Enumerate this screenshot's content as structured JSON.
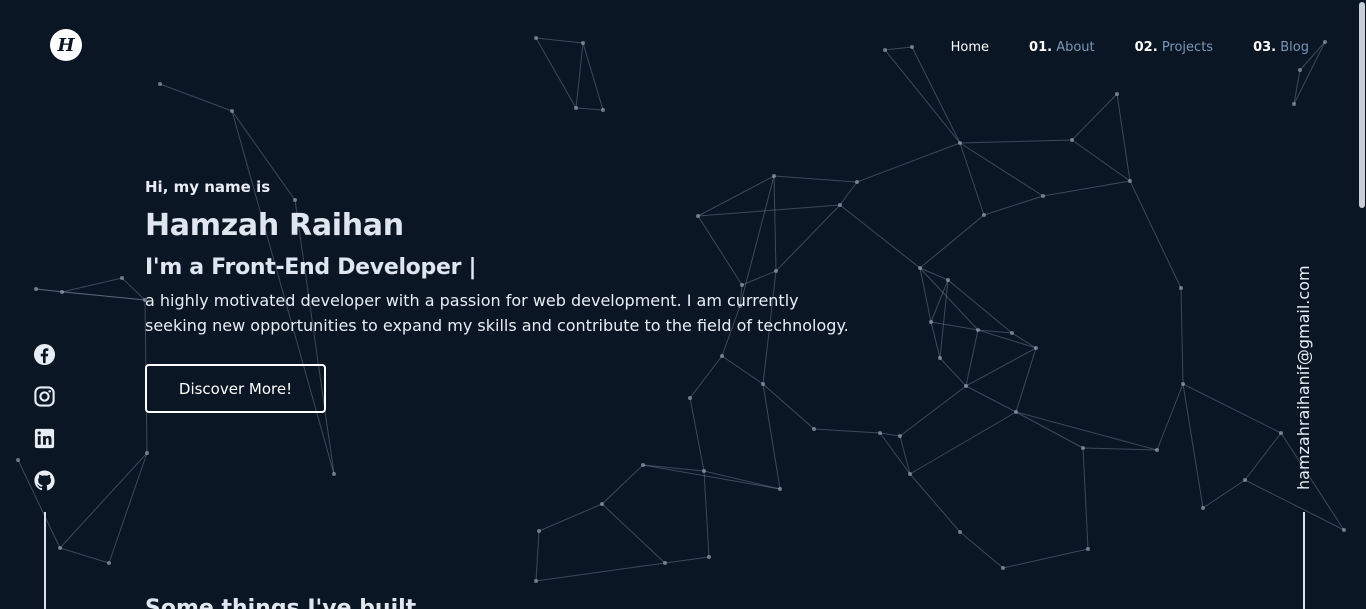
{
  "header": {
    "logo_glyph": "H",
    "nav": [
      {
        "num": "",
        "label": "Home"
      },
      {
        "num": "01.",
        "label": "About"
      },
      {
        "num": "02.",
        "label": "Projects"
      },
      {
        "num": "03.",
        "label": "Blog"
      }
    ]
  },
  "hero": {
    "greeting": "Hi, my name is",
    "name": "Hamzah Raihan",
    "role": "I'm a Front-End Developer |",
    "description": "a highly motivated developer with a passion for web development. I am currently seeking new opportunities to expand my skills and contribute to the field of technology.",
    "cta_label": "Discover More!"
  },
  "socials": [
    "facebook-icon",
    "instagram-icon",
    "linkedin-icon",
    "github-icon"
  ],
  "contact": {
    "email": "hamzahraihanif@gmail.com"
  },
  "next_section": {
    "heading": "Some things I've built"
  },
  "colors": {
    "background": "#0b1625",
    "accent_link": "#7b96b8",
    "text": "#e8edf5"
  }
}
